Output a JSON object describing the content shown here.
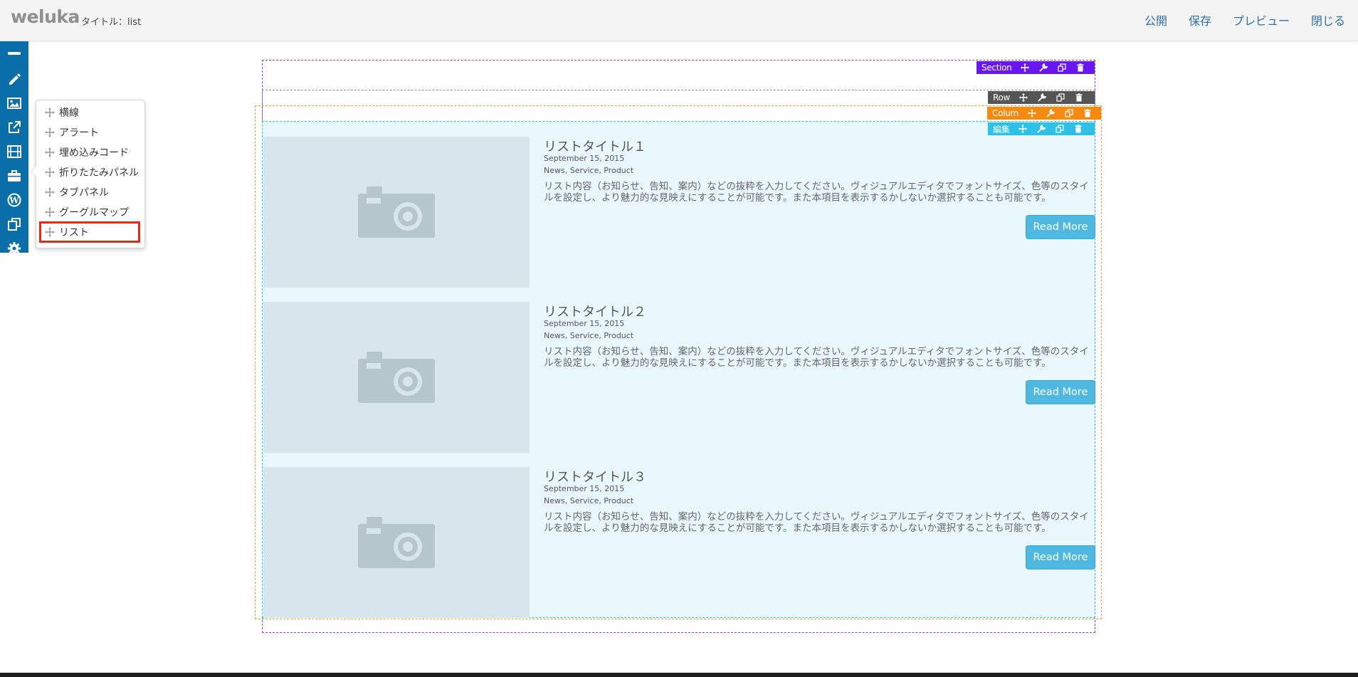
{
  "header": {
    "logo": "weluka",
    "page_title": "タイトル：list",
    "nav": {
      "publish": "公開",
      "save": "保存",
      "preview": "プレビュー",
      "close": "閉じる"
    }
  },
  "toolbar": {
    "tools": [
      {
        "icon": "minus-icon"
      },
      {
        "icon": "pencil-icon"
      },
      {
        "icon": "image-icon"
      },
      {
        "icon": "external-link-icon"
      },
      {
        "icon": "film-icon"
      },
      {
        "icon": "briefcase-icon"
      },
      {
        "icon": "wordpress-icon"
      },
      {
        "icon": "copy-icon"
      },
      {
        "icon": "gear-icon"
      }
    ]
  },
  "popup_menu": {
    "items": [
      {
        "label": "横線"
      },
      {
        "label": "アラート"
      },
      {
        "label": "埋め込みコード"
      },
      {
        "label": "折りたたみパネル"
      },
      {
        "label": "タブパネル"
      },
      {
        "label": "グーグルマップ"
      },
      {
        "label": "リスト"
      }
    ],
    "selected_index": 6
  },
  "controls": {
    "section": {
      "label": "Section",
      "color": "#6a16f0"
    },
    "row": {
      "label": "Row",
      "color": "#555555"
    },
    "column": {
      "label": "Colum",
      "color": "#f48a12"
    },
    "edit": {
      "label": "編集",
      "color": "#2ec0e6"
    }
  },
  "list": {
    "items": [
      {
        "title": "リストタイトル１",
        "date": "September 15, 2015",
        "categories": "News, Service, Product",
        "excerpt": "リスト内容（お知らせ、告知、案内）などの抜粋を入力してください。ヴィジュアルエディタでフォントサイズ、色等のスタイルを設定し、より魅力的な見映えにすることが可能です。また本項目を表示するかしないか選択することも可能です。",
        "button": "Read More"
      },
      {
        "title": "リストタイトル２",
        "date": "September 15, 2015",
        "categories": "News, Service, Product",
        "excerpt": "リスト内容（お知らせ、告知、案内）などの抜粋を入力してください。ヴィジュアルエディタでフォントサイズ、色等のスタイルを設定し、より魅力的な見映えにすることが可能です。また本項目を表示するかしないか選択することも可能です。",
        "button": "Read More"
      },
      {
        "title": "リストタイトル３",
        "date": "September 15, 2015",
        "categories": "News, Service, Product",
        "excerpt": "リスト内容（お知らせ、告知、案内）などの抜粋を入力してください。ヴィジュアルエディタでフォントサイズ、色等のスタイルを設定し、より魅力的な見映えにすることが可能です。また本項目を表示するかしないか選択することも可能です。",
        "button": "Read More"
      }
    ]
  }
}
